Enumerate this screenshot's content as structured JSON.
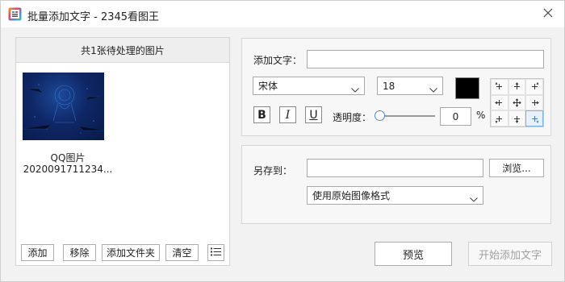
{
  "window": {
    "title": "批量添加文字 - 2345看图王",
    "app_icon": "app-logo-icon",
    "close_icon": "close-icon"
  },
  "image_list": {
    "header": "共1张待处理的图片",
    "items": [
      {
        "name_line1": "QQ图片",
        "name_line2": "2020091711234..."
      }
    ],
    "buttons": {
      "add": "添加",
      "remove": "移除",
      "add_folder": "添加文件夹",
      "clear": "清空",
      "list_view_icon": "list-icon"
    }
  },
  "text_settings": {
    "add_text_label": "添加文字：",
    "add_text_value": "",
    "font_family": "宋体",
    "font_size": "18",
    "color": "#000000",
    "bold_label": "B",
    "italic_label": "I",
    "underline_label": "U",
    "opacity_label": "透明度：",
    "opacity_value": "0",
    "opacity_unit": "%",
    "position_selected": "bottom-right"
  },
  "save_settings": {
    "save_to_label": "另存到：",
    "save_path": "",
    "browse_label": "浏览...",
    "format": "使用原始图像格式"
  },
  "actions": {
    "preview": "预览",
    "start": "开始添加文字"
  },
  "colors": {
    "selected_position": "#3a7fd0",
    "slider_accent": "#4a8fd6"
  }
}
